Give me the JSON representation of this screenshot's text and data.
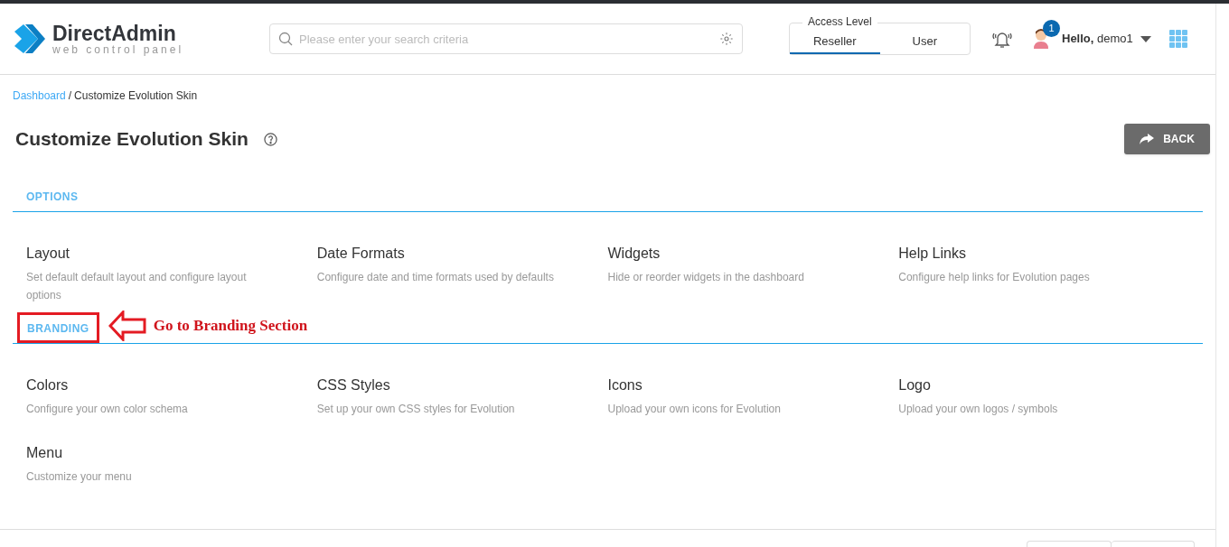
{
  "header": {
    "logo": {
      "name": "DirectAdmin",
      "tagline": "web control panel"
    },
    "search": {
      "placeholder": "Please enter your search criteria"
    },
    "access_level": {
      "label": "Access Level",
      "options": [
        {
          "label": "Reseller",
          "selected": true
        },
        {
          "label": "User",
          "selected": false
        }
      ]
    },
    "notifications_badge": "1",
    "greeting": {
      "hello": "Hello,",
      "user": "demo1"
    }
  },
  "breadcrumb": {
    "separator": "/",
    "items": [
      {
        "label": "Dashboard",
        "link": true
      },
      {
        "label": "Customize Evolution Skin",
        "link": false
      }
    ]
  },
  "page_title": "Customize Evolution Skin",
  "back_button": "BACK",
  "sections": [
    {
      "title": "OPTIONS",
      "highlighted": false,
      "items": [
        {
          "title": "Layout",
          "description": "Set default default layout and configure layout options"
        },
        {
          "title": "Date Formats",
          "description": "Configure date and time formats used by defaults"
        },
        {
          "title": "Widgets",
          "description": "Hide or reorder widgets in the dashboard"
        },
        {
          "title": "Help Links",
          "description": "Configure help links for Evolution pages"
        }
      ]
    },
    {
      "title": "BRANDING",
      "highlighted": true,
      "annotation": "Go to Branding Section",
      "items": [
        {
          "title": "Colors",
          "description": "Configure your own color schema"
        },
        {
          "title": "CSS Styles",
          "description": "Set up your own CSS styles for Evolution"
        },
        {
          "title": "Icons",
          "description": "Upload your own icons for Evolution"
        },
        {
          "title": "Logo",
          "description": "Upload your own logos / symbols"
        },
        {
          "title": "Menu",
          "description": "Customize your menu"
        }
      ]
    }
  ]
}
